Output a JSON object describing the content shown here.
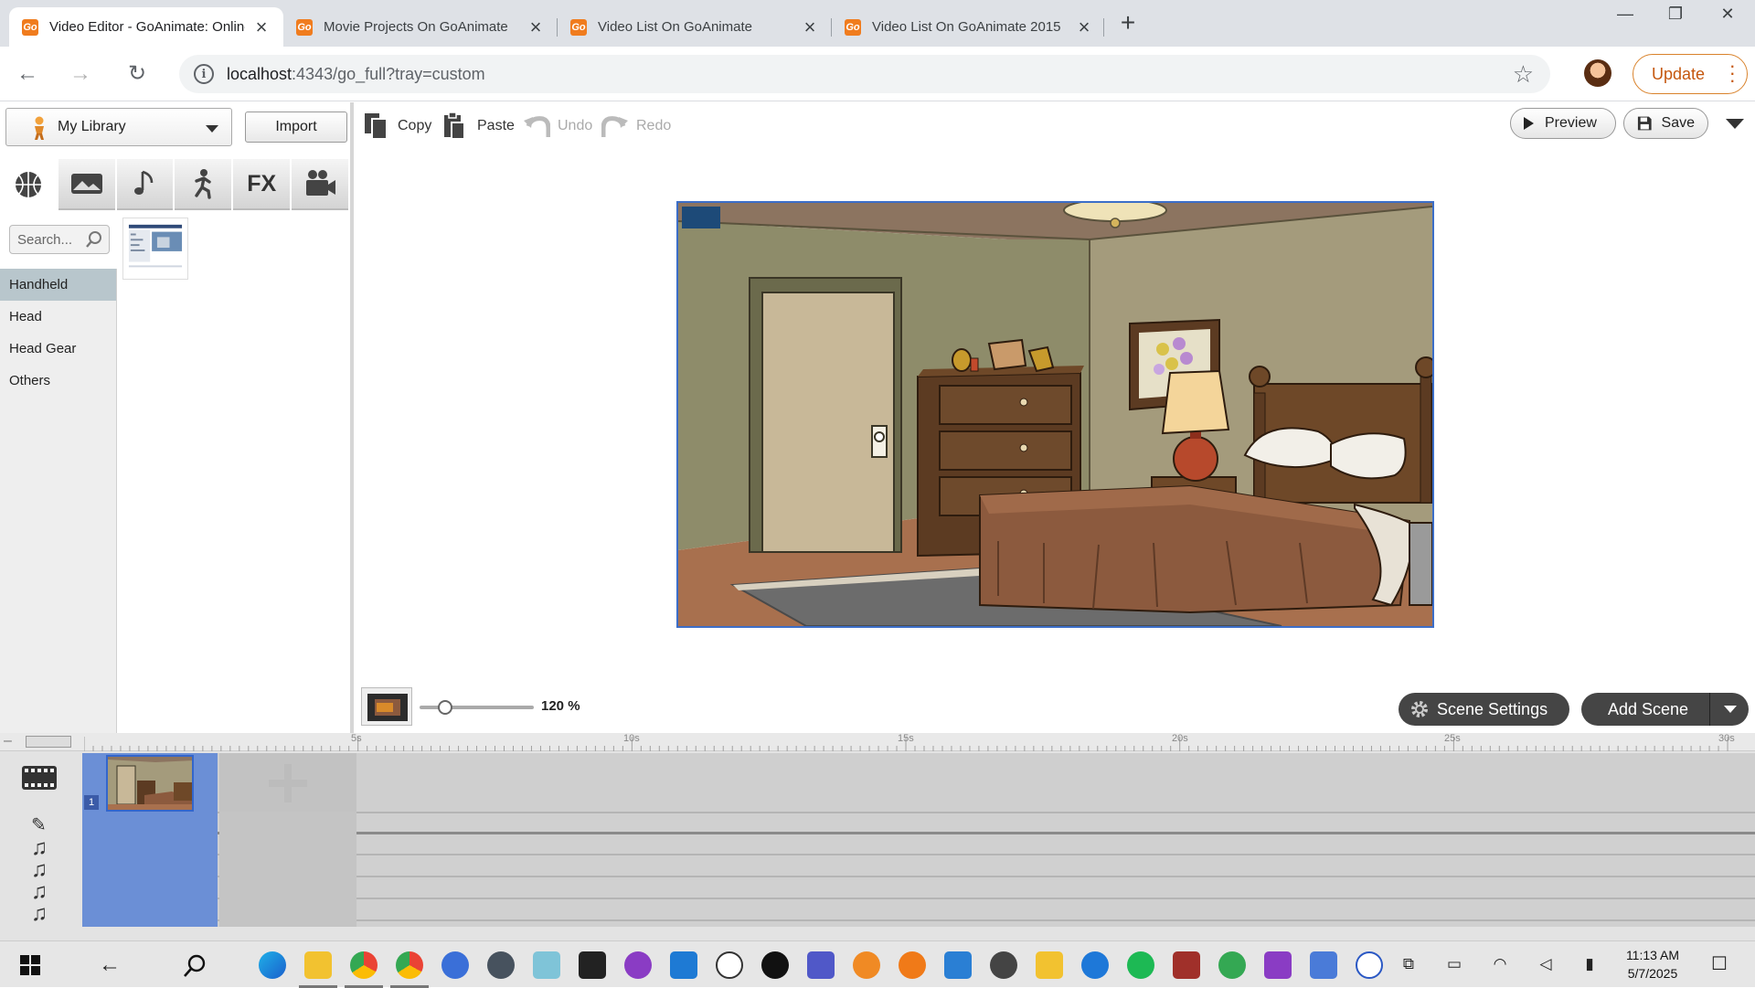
{
  "browser": {
    "tabs": [
      {
        "title": "Video Editor - GoAnimate: Online",
        "active": true
      },
      {
        "title": "Movie Projects On GoAnimate",
        "active": false
      },
      {
        "title": "Video List On GoAnimate",
        "active": false
      },
      {
        "title": "Video List On GoAnimate 2015",
        "active": false
      }
    ],
    "favicon_text": "Go",
    "url_host": "localhost",
    "url_path": ":4343/go_full?tray=custom",
    "update_label": "Update"
  },
  "library": {
    "selector_label": "My Library",
    "import_label": "Import",
    "search_placeholder": "Search...",
    "categories": [
      "props",
      "backgrounds",
      "music",
      "characters",
      "FX",
      "video"
    ],
    "fx_label": "FX",
    "subcategories": [
      "Handheld",
      "Head",
      "Head Gear",
      "Others"
    ],
    "selected_subcategory": "Handheld"
  },
  "toolbar": {
    "copy_label": "Copy",
    "paste_label": "Paste",
    "undo_label": "Undo",
    "redo_label": "Redo",
    "preview_label": "Preview",
    "save_label": "Save"
  },
  "stage": {
    "zoom_label": "120 %",
    "zoom_percent": 120,
    "scene_settings_label": "Scene Settings",
    "add_scene_label": "Add Scene"
  },
  "timeline": {
    "tick_labels": [
      "5s",
      "10s",
      "15s",
      "20s",
      "25s",
      "30s"
    ],
    "scene_number": "1"
  },
  "taskbar": {
    "time": "11:13 AM",
    "date": "5/7/2025"
  },
  "colors": {
    "accent_blue": "#6b8fd6",
    "brand_orange": "#f07c1e",
    "dark_button": "#454545"
  }
}
